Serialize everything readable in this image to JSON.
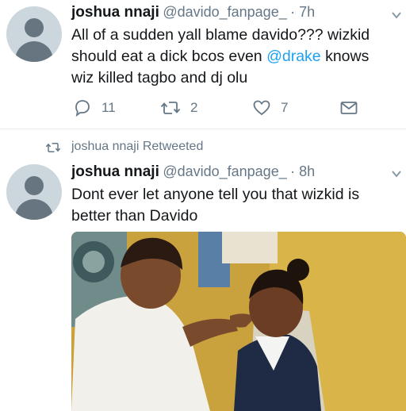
{
  "tweet1": {
    "name": "joshua nnaji",
    "handle": "@davido_fanpage_",
    "time": "· 7h",
    "text_line1": "All of a sudden yall blame davido??? wizkid",
    "text_line2_pre": "should eat a dick bcos even ",
    "mention": "@drake",
    "text_line2_post": " knows",
    "text_line3": "wiz killed tagbo and dj olu",
    "replies": "11",
    "retweets": "2",
    "likes": "7"
  },
  "retweet_label": "joshua nnaji Retweeted",
  "tweet2": {
    "name": "joshua nnaji",
    "handle": "@davido_fanpage_",
    "time": "· 8h",
    "text_line1": "Dont ever let anyone tell you that wizkid is",
    "text_line2": "better than Davido"
  },
  "icons": {
    "reply": "reply-icon",
    "retweet": "retweet-icon",
    "like": "heart-icon",
    "dm": "mail-icon",
    "caret": "chevron-down-icon"
  }
}
